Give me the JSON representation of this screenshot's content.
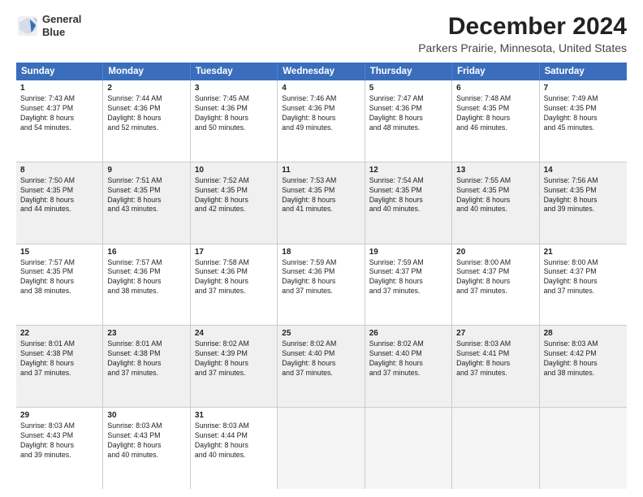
{
  "logo": {
    "line1": "General",
    "line2": "Blue"
  },
  "title": "December 2024",
  "subtitle": "Parkers Prairie, Minnesota, United States",
  "headers": [
    "Sunday",
    "Monday",
    "Tuesday",
    "Wednesday",
    "Thursday",
    "Friday",
    "Saturday"
  ],
  "weeks": [
    [
      {
        "day": "1",
        "lines": [
          "Sunrise: 7:43 AM",
          "Sunset: 4:37 PM",
          "Daylight: 8 hours",
          "and 54 minutes."
        ]
      },
      {
        "day": "2",
        "lines": [
          "Sunrise: 7:44 AM",
          "Sunset: 4:36 PM",
          "Daylight: 8 hours",
          "and 52 minutes."
        ]
      },
      {
        "day": "3",
        "lines": [
          "Sunrise: 7:45 AM",
          "Sunset: 4:36 PM",
          "Daylight: 8 hours",
          "and 50 minutes."
        ]
      },
      {
        "day": "4",
        "lines": [
          "Sunrise: 7:46 AM",
          "Sunset: 4:36 PM",
          "Daylight: 8 hours",
          "and 49 minutes."
        ]
      },
      {
        "day": "5",
        "lines": [
          "Sunrise: 7:47 AM",
          "Sunset: 4:36 PM",
          "Daylight: 8 hours",
          "and 48 minutes."
        ]
      },
      {
        "day": "6",
        "lines": [
          "Sunrise: 7:48 AM",
          "Sunset: 4:35 PM",
          "Daylight: 8 hours",
          "and 46 minutes."
        ]
      },
      {
        "day": "7",
        "lines": [
          "Sunrise: 7:49 AM",
          "Sunset: 4:35 PM",
          "Daylight: 8 hours",
          "and 45 minutes."
        ]
      }
    ],
    [
      {
        "day": "8",
        "lines": [
          "Sunrise: 7:50 AM",
          "Sunset: 4:35 PM",
          "Daylight: 8 hours",
          "and 44 minutes."
        ],
        "shaded": true
      },
      {
        "day": "9",
        "lines": [
          "Sunrise: 7:51 AM",
          "Sunset: 4:35 PM",
          "Daylight: 8 hours",
          "and 43 minutes."
        ],
        "shaded": true
      },
      {
        "day": "10",
        "lines": [
          "Sunrise: 7:52 AM",
          "Sunset: 4:35 PM",
          "Daylight: 8 hours",
          "and 42 minutes."
        ],
        "shaded": true
      },
      {
        "day": "11",
        "lines": [
          "Sunrise: 7:53 AM",
          "Sunset: 4:35 PM",
          "Daylight: 8 hours",
          "and 41 minutes."
        ],
        "shaded": true
      },
      {
        "day": "12",
        "lines": [
          "Sunrise: 7:54 AM",
          "Sunset: 4:35 PM",
          "Daylight: 8 hours",
          "and 40 minutes."
        ],
        "shaded": true
      },
      {
        "day": "13",
        "lines": [
          "Sunrise: 7:55 AM",
          "Sunset: 4:35 PM",
          "Daylight: 8 hours",
          "and 40 minutes."
        ],
        "shaded": true
      },
      {
        "day": "14",
        "lines": [
          "Sunrise: 7:56 AM",
          "Sunset: 4:35 PM",
          "Daylight: 8 hours",
          "and 39 minutes."
        ],
        "shaded": true
      }
    ],
    [
      {
        "day": "15",
        "lines": [
          "Sunrise: 7:57 AM",
          "Sunset: 4:35 PM",
          "Daylight: 8 hours",
          "and 38 minutes."
        ]
      },
      {
        "day": "16",
        "lines": [
          "Sunrise: 7:57 AM",
          "Sunset: 4:36 PM",
          "Daylight: 8 hours",
          "and 38 minutes."
        ]
      },
      {
        "day": "17",
        "lines": [
          "Sunrise: 7:58 AM",
          "Sunset: 4:36 PM",
          "Daylight: 8 hours",
          "and 37 minutes."
        ]
      },
      {
        "day": "18",
        "lines": [
          "Sunrise: 7:59 AM",
          "Sunset: 4:36 PM",
          "Daylight: 8 hours",
          "and 37 minutes."
        ]
      },
      {
        "day": "19",
        "lines": [
          "Sunrise: 7:59 AM",
          "Sunset: 4:37 PM",
          "Daylight: 8 hours",
          "and 37 minutes."
        ]
      },
      {
        "day": "20",
        "lines": [
          "Sunrise: 8:00 AM",
          "Sunset: 4:37 PM",
          "Daylight: 8 hours",
          "and 37 minutes."
        ]
      },
      {
        "day": "21",
        "lines": [
          "Sunrise: 8:00 AM",
          "Sunset: 4:37 PM",
          "Daylight: 8 hours",
          "and 37 minutes."
        ]
      }
    ],
    [
      {
        "day": "22",
        "lines": [
          "Sunrise: 8:01 AM",
          "Sunset: 4:38 PM",
          "Daylight: 8 hours",
          "and 37 minutes."
        ],
        "shaded": true
      },
      {
        "day": "23",
        "lines": [
          "Sunrise: 8:01 AM",
          "Sunset: 4:38 PM",
          "Daylight: 8 hours",
          "and 37 minutes."
        ],
        "shaded": true
      },
      {
        "day": "24",
        "lines": [
          "Sunrise: 8:02 AM",
          "Sunset: 4:39 PM",
          "Daylight: 8 hours",
          "and 37 minutes."
        ],
        "shaded": true
      },
      {
        "day": "25",
        "lines": [
          "Sunrise: 8:02 AM",
          "Sunset: 4:40 PM",
          "Daylight: 8 hours",
          "and 37 minutes."
        ],
        "shaded": true
      },
      {
        "day": "26",
        "lines": [
          "Sunrise: 8:02 AM",
          "Sunset: 4:40 PM",
          "Daylight: 8 hours",
          "and 37 minutes."
        ],
        "shaded": true
      },
      {
        "day": "27",
        "lines": [
          "Sunrise: 8:03 AM",
          "Sunset: 4:41 PM",
          "Daylight: 8 hours",
          "and 37 minutes."
        ],
        "shaded": true
      },
      {
        "day": "28",
        "lines": [
          "Sunrise: 8:03 AM",
          "Sunset: 4:42 PM",
          "Daylight: 8 hours",
          "and 38 minutes."
        ],
        "shaded": true
      }
    ],
    [
      {
        "day": "29",
        "lines": [
          "Sunrise: 8:03 AM",
          "Sunset: 4:43 PM",
          "Daylight: 8 hours",
          "and 39 minutes."
        ]
      },
      {
        "day": "30",
        "lines": [
          "Sunrise: 8:03 AM",
          "Sunset: 4:43 PM",
          "Daylight: 8 hours",
          "and 40 minutes."
        ]
      },
      {
        "day": "31",
        "lines": [
          "Sunrise: 8:03 AM",
          "Sunset: 4:44 PM",
          "Daylight: 8 hours",
          "and 40 minutes."
        ]
      },
      {
        "day": "",
        "lines": [],
        "empty": true
      },
      {
        "day": "",
        "lines": [],
        "empty": true
      },
      {
        "day": "",
        "lines": [],
        "empty": true
      },
      {
        "day": "",
        "lines": [],
        "empty": true
      }
    ]
  ]
}
